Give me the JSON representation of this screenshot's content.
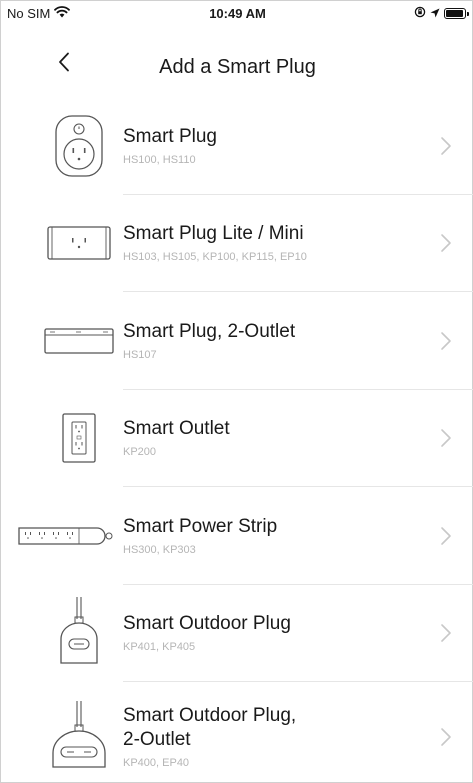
{
  "status_bar": {
    "carrier": "No SIM",
    "time": "10:49 AM"
  },
  "nav": {
    "title": "Add a Smart Plug",
    "back_icon": "chevron-left-icon"
  },
  "devices": [
    {
      "name": "Smart Plug",
      "models": "HS100, HS110",
      "icon": "smart-plug-icon"
    },
    {
      "name": "Smart Plug Lite / Mini",
      "models": "HS103, HS105, KP100, KP115, EP10",
      "icon": "smart-plug-lite-icon"
    },
    {
      "name": "Smart Plug, 2-Outlet",
      "models": "HS107",
      "icon": "smart-plug-2-outlet-icon"
    },
    {
      "name": "Smart Outlet",
      "models": "KP200",
      "icon": "smart-outlet-icon"
    },
    {
      "name": "Smart Power Strip",
      "models": "HS300, KP303",
      "icon": "power-strip-icon"
    },
    {
      "name": "Smart Outdoor Plug",
      "models": "KP401, KP405",
      "icon": "outdoor-plug-icon"
    },
    {
      "name": "Smart Outdoor Plug,\n2-Outlet",
      "name_line1": "Smart Outdoor Plug,",
      "name_line2": "2-Outlet",
      "models": "KP400, EP40",
      "icon": "outdoor-plug-2-outlet-icon"
    }
  ],
  "colors": {
    "text": "#1a1a1a",
    "subtext": "#b5b5b5",
    "chevron": "#c8c8c8",
    "divider": "#e6e6e6",
    "icon_stroke": "#555555"
  }
}
